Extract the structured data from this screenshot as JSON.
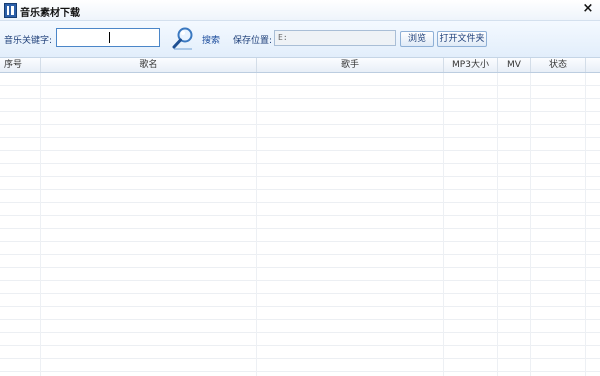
{
  "window": {
    "title": "音乐素材下载",
    "close_glyph": "×",
    "app_icon": "app-icon"
  },
  "toolbar": {
    "keyword_label": "音乐关键字:",
    "keyword_value": "",
    "search_icon": "magnifier-icon",
    "search_label": "搜索",
    "save_label": "保存位置:",
    "save_path": "E:",
    "browse_label": "浏览",
    "open_folder_label": "打开文件夹"
  },
  "table": {
    "columns": [
      {
        "label": "序号"
      },
      {
        "label": "歌名"
      },
      {
        "label": "歌手"
      },
      {
        "label": "MP3大小"
      },
      {
        "label": "MV"
      },
      {
        "label": "状态"
      }
    ],
    "rows": []
  },
  "colors": {
    "accent": "#4b86c8",
    "toolbar_bg": "#e2eefb",
    "label_text": "#1e3f79"
  }
}
